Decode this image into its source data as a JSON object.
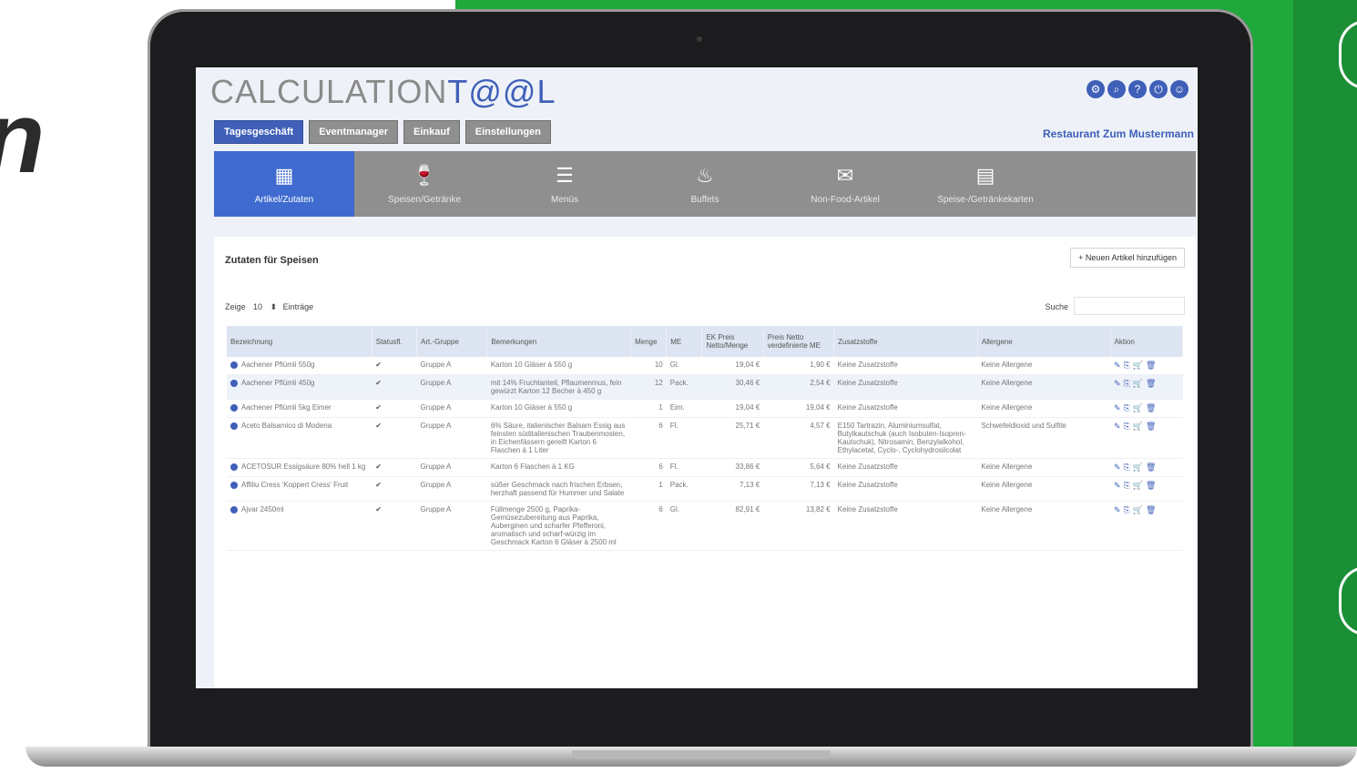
{
  "app": {
    "logo_prefix": "CALCULATION",
    "logo_suffix": "T@@L",
    "restaurant": "Restaurant Zum Mustermann",
    "header_icons": [
      "cog-icon",
      "search-icon",
      "help-icon",
      "power-icon",
      "user-icon"
    ]
  },
  "decor": {
    "left_letter": "n"
  },
  "top_tabs": [
    "Tagesgeschäft",
    "Eventmanager",
    "Einkauf",
    "Einstellungen"
  ],
  "nav": [
    {
      "label": "Artikel/Zutaten",
      "icon": "▦"
    },
    {
      "label": "Speisen/Getränke",
      "icon": "🍷"
    },
    {
      "label": "Menüs",
      "icon": "☰"
    },
    {
      "label": "Buffets",
      "icon": "♨"
    },
    {
      "label": "Non-Food-Artikel",
      "icon": "✉"
    },
    {
      "label": "Speise-/Getränkekarten",
      "icon": "▤"
    }
  ],
  "card": {
    "title": "Zutaten für Speisen",
    "add_button": "+ Neuen Artikel hinzufügen",
    "show_label": "Zeige",
    "show_value": "10",
    "entries_label": "Einträge",
    "search_label": "Suche"
  },
  "table": {
    "headers": [
      "Bezeichnung",
      "Statusfl.",
      "Art.-Gruppe",
      "Bemerkungen",
      "Menge",
      "ME",
      "EK Preis Netto/Menge",
      "Preis Netto verdefinierte ME",
      "Zusatzstoffe",
      "Allergene",
      "Aktion"
    ],
    "rows": [
      {
        "name": "Aachener Pflümli 550g",
        "group": "Gruppe A",
        "note": "Karton 10 Gläser à 550 g",
        "qty": "10",
        "unit": "Gl.",
        "ek": "19,04 €",
        "price": "1,90 €",
        "additives": "Keine Zusatzstoffe",
        "allergens": "Keine Allergene"
      },
      {
        "name": "Aachener Pflümli 450g",
        "group": "Gruppe A",
        "note": "mit 14% Fruchtanteil, Pflaumenmus, fein gewürzt Karton 12 Becher à 450 g",
        "qty": "12",
        "unit": "Pack.",
        "ek": "30,46 €",
        "price": "2,54 €",
        "additives": "Keine Zusatzstoffe",
        "allergens": "Keine Allergene"
      },
      {
        "name": "Aachener Pflümli 5kg Eimer",
        "group": "Gruppe A",
        "note": "Karton 10 Gläser à 550 g",
        "qty": "1",
        "unit": "Eim.",
        "ek": "19,04 €",
        "price": "19,04 €",
        "additives": "Keine Zusatzstoffe",
        "allergens": "Keine Allergene"
      },
      {
        "name": "Aceto Balsamico di Modena",
        "group": "Gruppe A",
        "note": "6% Säure, italienischer Balsam Essig aus feinsten süditalienischen Traubenmosten, in Eichenfässern gereift Karton 6 Flaschen à 1 Liter",
        "qty": "6",
        "unit": "Fl.",
        "ek": "25,71 €",
        "price": "4,57 €",
        "additives": "E150 Tartrazin, Aluminiumsulfat, Butylkautschuk (auch Isobuten-Isopren-Kautschuk), Nitrosamin, Benzylalkohol, Ethylacetat, Cyclo-, Cyclohydrosilcolat",
        "allergens": "Schwefeldioxid und Sulfite"
      },
      {
        "name": "ACETOSUR Essigsäure 80% hell 1 kg",
        "group": "Gruppe A",
        "note": "Karton 6 Flaschen à 1 KG",
        "qty": "6",
        "unit": "Fl.",
        "ek": "33,86 €",
        "price": "5,64 €",
        "additives": "Keine Zusatzstoffe",
        "allergens": "Keine Allergene"
      },
      {
        "name": "Affiliu Cress 'Koppert Cress' Fruit",
        "group": "Gruppe A",
        "note": "süßer Geschmack nach frischen Erbsen, herzhaft passend für Hummer und Salate",
        "qty": "1",
        "unit": "Pack.",
        "ek": "7,13 €",
        "price": "7,13 €",
        "additives": "Keine Zusatzstoffe",
        "allergens": "Keine Allergene"
      },
      {
        "name": "Ajvar 2450ml",
        "group": "Gruppe A",
        "note": "Füllmenge 2500 g, Paprika-Gemüsezubereitung aus Paprika, Auberginen und scharfer Pfefferoni, aromatisch und scharf-würzig im Geschmack Karton 6 Gläser à 2500 ml",
        "qty": "6",
        "unit": "Gl.",
        "ek": "82,91 €",
        "price": "13,82 €",
        "additives": "Keine Zusatzstoffe",
        "allergens": "Keine Allergene"
      }
    ]
  }
}
